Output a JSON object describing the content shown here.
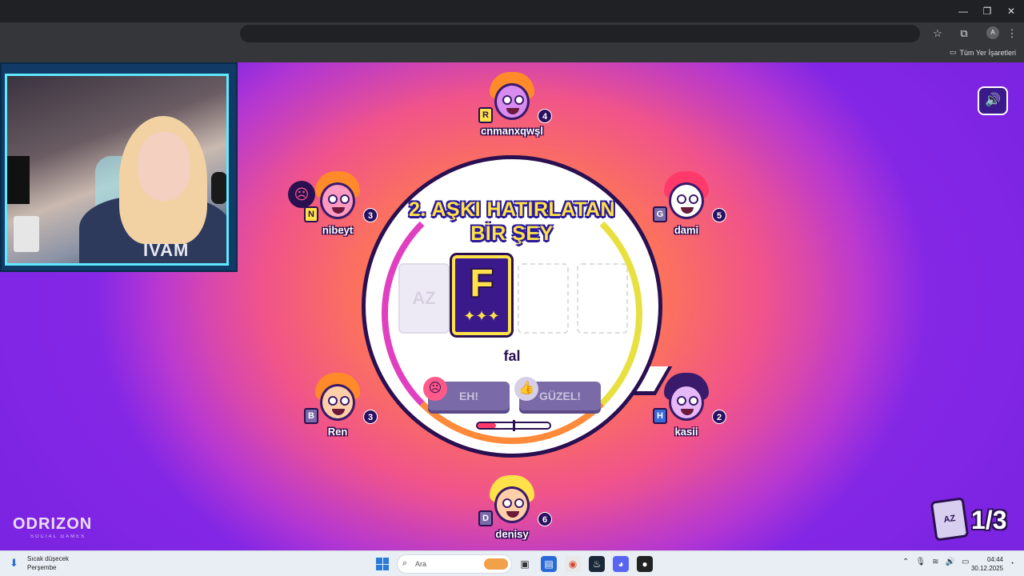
{
  "browser": {
    "bookmarks_all": "Tüm Yer İşaretleri",
    "profile_initial": "A"
  },
  "game": {
    "prompt_line1": "2. AŞKI HATIRLATAN",
    "prompt_line2": "BİR ŞEY",
    "empty_card_label": "AZ",
    "card_letter": "F",
    "card_stars": "✦✦✦",
    "answer": "fal",
    "vote_bad": "EH!",
    "vote_good": "GÜZEL!",
    "slider_level": 0.25,
    "round_card_label": "AZ",
    "round_counter": "1/3"
  },
  "players": [
    {
      "name": "cnmanxqwşl",
      "tile": "R",
      "score": "4",
      "hair": "#ff8a2a",
      "skin": "#d88cf0",
      "tile_color": "#ffe24a"
    },
    {
      "name": "nibeyt",
      "tile": "N",
      "score": "3",
      "hair": "#ff8a2a",
      "skin": "#ff9ac0",
      "tile_color": "#ffe24a"
    },
    {
      "name": "dami",
      "tile": "G",
      "score": "5",
      "hair": "#ff3a6a",
      "skin": "#ffffff",
      "tile_color": "#7a6aa8"
    },
    {
      "name": "Ren",
      "tile": "B",
      "score": "3",
      "hair": "#ff8a2a",
      "skin": "#ffd0a8",
      "tile_color": "#7a6aa8"
    },
    {
      "name": "kasii",
      "tile": "H",
      "score": "2",
      "hair": "#3a1a6a",
      "skin": "#e6b8f8",
      "tile_color": "#3a6ad8"
    },
    {
      "name": "denisy",
      "tile": "D",
      "score": "6",
      "hair": "#ffe24a",
      "skin": "#ffd0a8",
      "tile_color": "#7a6aa8"
    }
  ],
  "webcam": {
    "shirt_text": "IVAM"
  },
  "logo": {
    "name": "ODRIZON",
    "subtitle": "SOCIAL GAMES"
  },
  "taskbar": {
    "weather_line1": "Sıcak düşecek",
    "weather_line2": "Perşembe",
    "search_placeholder": "Ara",
    "time": "04:44",
    "date": "30.12.2025"
  },
  "colors": {
    "accent_yellow": "#ffe24a",
    "outline_purple": "#2a1050"
  }
}
